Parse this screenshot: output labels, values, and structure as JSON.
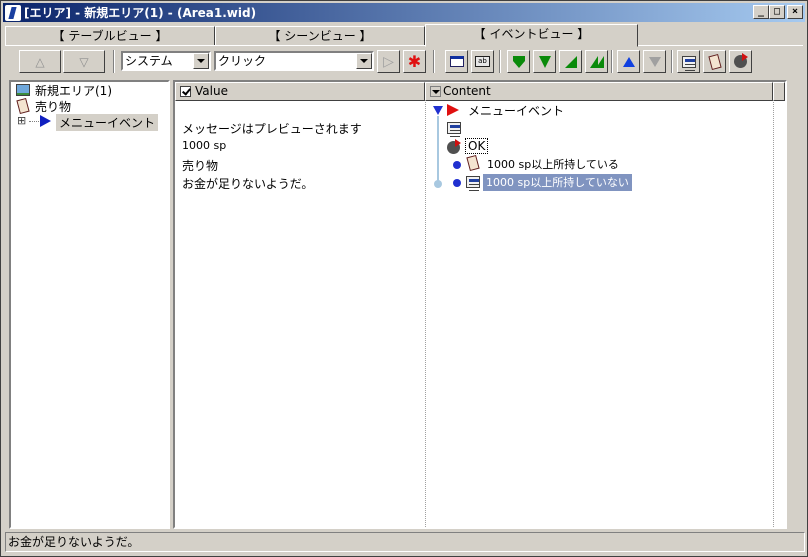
{
  "window": {
    "title": "[エリア] - 新規エリア(1) - (Area1.wid)",
    "minimize": "_",
    "maximize": "□",
    "close": "×"
  },
  "tabs": [
    {
      "label": "【 テーブルビュー 】",
      "active": false
    },
    {
      "label": "【 シーンビュー 】",
      "active": false
    },
    {
      "label": "【 イベントビュー 】",
      "active": true
    }
  ],
  "toolbar": {
    "up_label": "△",
    "down_label": "▽",
    "category_value": "システム",
    "action_value": "クリック",
    "play_glyph": "▷",
    "stop_glyph": "✱",
    "colors": {
      "green": "#0a8a0a",
      "blue": "#1040e0",
      "red": "#e01010",
      "gray": "#a0a0a0"
    }
  },
  "tree": {
    "items": [
      {
        "label": "新規エリア(1)",
        "icon": "landscape-icon"
      },
      {
        "label": "売り物",
        "icon": "card-icon"
      },
      {
        "label": "メニューイベント",
        "icon": "event-triangle-icon",
        "selected": true
      }
    ],
    "expander": "⊞"
  },
  "main": {
    "value_header": "Value",
    "content_header": "Content",
    "values": [
      "メッセージはプレビューされます",
      "1000 sp",
      "売り物",
      "お金が足りないようだ。"
    ],
    "content": {
      "root": "メニューイベント",
      "ok": "OK",
      "branches": [
        "1000 sp以上所持している",
        "1000 sp以上所持していない"
      ]
    }
  },
  "status": {
    "text": "お金が足りないようだ。"
  },
  "colors": {
    "title_start": "#0a246a",
    "title_end": "#a6caf0",
    "selection": "#8094c0",
    "face": "#d4d0c8"
  }
}
